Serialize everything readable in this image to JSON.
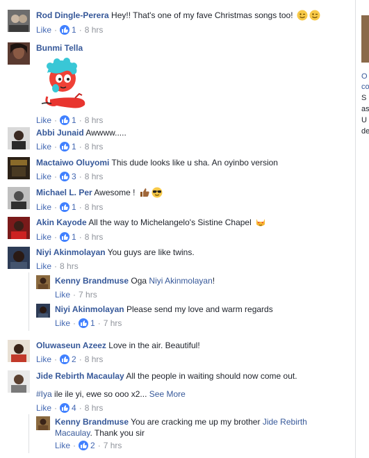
{
  "like_label": "Like",
  "dot": "·",
  "comments": [
    {
      "author": "Rod Dingle-Perera",
      "text": "Hey!! That's one of my fave Christmas songs too!",
      "likes": "1",
      "time": "8 hrs",
      "avatar_color": "#6d6d6d"
    },
    {
      "author": "Bunmi Tella",
      "text": "",
      "likes": "1",
      "time": "8 hrs",
      "avatar_color": "#5a3a30"
    },
    {
      "author": "Abbi Junaid",
      "text": "Awwww.....",
      "likes": "1",
      "time": "8 hrs",
      "avatar_color": "#3a3a3a"
    },
    {
      "author": "Mactaiwo Oluyomi",
      "text": "This dude looks like u sha. An oyinbo version",
      "likes": "3",
      "time": "8 hrs",
      "avatar_color": "#2b2117"
    },
    {
      "author": "Michael L. Per",
      "text": "Awesome !",
      "likes": "1",
      "time": "8 hrs",
      "avatar_color": "#4f4f4f"
    },
    {
      "author": "Akin Kayode",
      "text": "All the way to Michelangelo's Sistine Chapel",
      "likes": "1",
      "time": "8 hrs",
      "avatar_color": "#7a1a1a"
    },
    {
      "author": "Niyi Akinmolayan",
      "text": "You guys are like twins.",
      "time": "8 hrs",
      "avatar_color": "#2d3b55"
    },
    {
      "author": "Oluwaseun Azeez",
      "text": "Love in the air. Beautiful!",
      "likes": "2",
      "time": "8 hrs",
      "avatar_color": "#5b4a3a"
    },
    {
      "author": "Jide Rebirth Macaulay",
      "text": "All the people in waiting should now come out.",
      "text2_hashtag": "#Iya",
      "text2": "ile ile yi, ewe so ooo x2...",
      "see_more": "See More",
      "likes": "4",
      "time": "8 hrs",
      "avatar_color": "#7a7a7a"
    }
  ],
  "replies": [
    {
      "author": "Kenny Brandmuse",
      "text_prefix": "Oga",
      "mention": "Niyi Akinmolayan",
      "text_suffix": "!",
      "time": "7 hrs",
      "avatar_color": "#8b6a3f"
    },
    {
      "author": "Niyi Akinmolayan",
      "text": "Please send my love and warm regards",
      "likes": "1",
      "time": "7 hrs",
      "avatar_color": "#2d3b55"
    },
    {
      "author": "Kenny Brandmuse",
      "text_prefix": "You are cracking me up my brother",
      "mention_line1": "Jide Rebirth",
      "mention_line2": "Macaulay",
      "text_suffix": ". Thank you sir",
      "likes": "2",
      "time": "7 hrs",
      "avatar_color": "#8b6a3f"
    }
  ],
  "sidebar": {
    "lines": [
      "O",
      "co",
      "S",
      "as",
      "U",
      "de"
    ]
  }
}
